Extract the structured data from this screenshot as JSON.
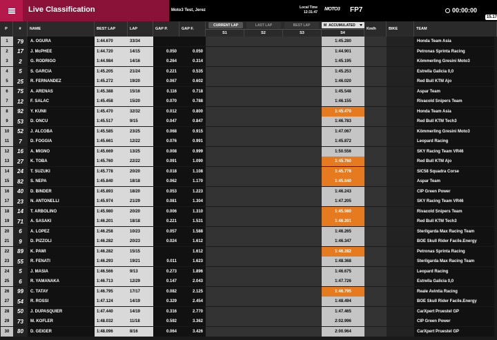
{
  "header": {
    "title": "Live Classification",
    "session": "Moto3 Test, Jerez",
    "local_time_label": "Local Time",
    "local_time": "12:31:47",
    "logo_text": "MOTO3",
    "session_code": "FP7",
    "clock": "00:00:00",
    "side_tag": "15.17"
  },
  "columns": {
    "p": "P",
    "num": "#",
    "name": "NAME",
    "best_lap": "BEST LAP",
    "lap": "LAP",
    "gap_p": "GAP P.",
    "gap_f": "GAP F.",
    "current_lap": "CURRENT LAP",
    "last_lap": "LAST LAP",
    "best_lap_pill": "BEST LAP",
    "s1": "S1",
    "s2": "S2",
    "s3": "S3",
    "s4": "S4",
    "kmh": "Km/h",
    "bike": "BIKE",
    "team": "TEAM",
    "mode_select": "ACCUMULATED",
    "mode_prefix": "M"
  },
  "colors": {
    "accent": "#b5184a",
    "highlight": "#e57a1f"
  },
  "rows": [
    {
      "p": "1",
      "num": "79",
      "name": "A. OGURA",
      "best": "1:44.670",
      "lap": "33/34",
      "gapp": "",
      "gapf": "",
      "s4": "1:45.280",
      "hl": false,
      "team": "Honda Team Asia"
    },
    {
      "p": "2",
      "num": "17",
      "name": "J. McPHEE",
      "best": "1:44.720",
      "lap": "14/15",
      "gapp": "0.050",
      "gapf": "0.050",
      "s4": "1:44.901",
      "hl": false,
      "team": "Petronas Sprinta Racing"
    },
    {
      "p": "3",
      "num": "2",
      "name": "G. RODRIGO",
      "best": "1:44.984",
      "lap": "14/16",
      "gapp": "0.264",
      "gapf": "0.314",
      "s4": "1:45.195",
      "hl": false,
      "team": "Kömmerling Gresini Moto3"
    },
    {
      "p": "4",
      "num": "5",
      "name": "S. GARCIA",
      "best": "1:45.205",
      "lap": "21/24",
      "gapp": "0.221",
      "gapf": "0.535",
      "s4": "1:45.253",
      "hl": false,
      "team": "Estrella Galicia 0,0"
    },
    {
      "p": "5",
      "num": "25",
      "name": "R. FERNANDEZ",
      "best": "1:45.272",
      "lap": "19/20",
      "gapp": "0.067",
      "gapf": "0.602",
      "s4": "1:46.020",
      "hl": false,
      "team": "Red Bull KTM Ajo"
    },
    {
      "p": "6",
      "num": "75",
      "name": "A. ARENAS",
      "best": "1:45.388",
      "lap": "15/16",
      "gapp": "0.116",
      "gapf": "0.718",
      "s4": "1:45.548",
      "hl": false,
      "team": "Aspar Team"
    },
    {
      "p": "7",
      "num": "12",
      "name": "F. SALAC",
      "best": "1:45.458",
      "lap": "15/20",
      "gapp": "0.070",
      "gapf": "0.788",
      "s4": "1:46.155",
      "hl": false,
      "team": "Rivacold Snipers Team"
    },
    {
      "p": "8",
      "num": "92",
      "name": "Y. KUNII",
      "best": "1:45.470",
      "lap": "32/32",
      "gapp": "0.012",
      "gapf": "0.800",
      "s4": "1:45.470",
      "hl": true,
      "team": "Honda Team Asia"
    },
    {
      "p": "9",
      "num": "53",
      "name": "D. ONCU",
      "best": "1:45.517",
      "lap": "9/15",
      "gapp": "0.047",
      "gapf": "0.847",
      "s4": "1:46.783",
      "hl": false,
      "team": "Red Bull KTM Tech3"
    },
    {
      "p": "10",
      "num": "52",
      "name": "J. ALCOBA",
      "best": "1:45.585",
      "lap": "23/25",
      "gapp": "0.068",
      "gapf": "0.915",
      "s4": "1:47.067",
      "hl": false,
      "team": "Kömmerling Gresini Moto3"
    },
    {
      "p": "11",
      "num": "7",
      "name": "D. FOGGIA",
      "best": "1:45.661",
      "lap": "12/22",
      "gapp": "0.076",
      "gapf": "0.991",
      "s4": "1:45.872",
      "hl": false,
      "team": "Leopard Racing"
    },
    {
      "p": "12",
      "num": "16",
      "name": "A. MIGNO",
      "best": "1:45.669",
      "lap": "13/25",
      "gapp": "0.008",
      "gapf": "0.999",
      "s4": "1:50.556",
      "hl": false,
      "team": "SKY Racing Team VR46"
    },
    {
      "p": "13",
      "num": "27",
      "name": "K. TOBA",
      "best": "1:45.760",
      "lap": "22/22",
      "gapp": "0.091",
      "gapf": "1.090",
      "s4": "1:45.760",
      "hl": true,
      "team": "Red Bull KTM Ajo"
    },
    {
      "p": "14",
      "num": "24",
      "name": "T. SUZUKI",
      "best": "1:45.778",
      "lap": "20/20",
      "gapp": "0.018",
      "gapf": "1.108",
      "s4": "1:45.778",
      "hl": true,
      "team": "SIC58 Squadra Corse"
    },
    {
      "p": "15",
      "num": "82",
      "name": "S. NEPA",
      "best": "1:45.840",
      "lap": "18/18",
      "gapp": "0.062",
      "gapf": "1.170",
      "s4": "1:45.840",
      "hl": true,
      "team": "Aspar Team"
    },
    {
      "p": "16",
      "num": "40",
      "name": "D. BINDER",
      "best": "1:45.893",
      "lap": "18/20",
      "gapp": "0.053",
      "gapf": "1.223",
      "s4": "1:46.243",
      "hl": false,
      "team": "CIP Green Power"
    },
    {
      "p": "17",
      "num": "23",
      "name": "N. ANTONELLI",
      "best": "1:45.974",
      "lap": "21/29",
      "gapp": "0.081",
      "gapf": "1.304",
      "s4": "1:47.205",
      "hl": false,
      "team": "SKY Racing Team VR46"
    },
    {
      "p": "18",
      "num": "14",
      "name": "T. ARBOLINO",
      "best": "1:45.980",
      "lap": "20/20",
      "gapp": "0.006",
      "gapf": "1.310",
      "s4": "1:45.980",
      "hl": true,
      "team": "Rivacold Snipers Team"
    },
    {
      "p": "19",
      "num": "71",
      "name": "A. SASAKI",
      "best": "1:46.201",
      "lap": "18/18",
      "gapp": "0.221",
      "gapf": "1.531",
      "s4": "1:46.201",
      "hl": true,
      "team": "Red Bull KTM Tech3"
    },
    {
      "p": "20",
      "num": "6",
      "name": "A. LOPEZ",
      "best": "1:46.258",
      "lap": "10/23",
      "gapp": "0.057",
      "gapf": "1.588",
      "s4": "1:46.265",
      "hl": false,
      "team": "Sterilgarda Max Racing Team"
    },
    {
      "p": "21",
      "num": "9",
      "name": "D. PIZZOLI",
      "best": "1:46.282",
      "lap": "20/23",
      "gapp": "0.024",
      "gapf": "1.612",
      "s4": "1:46.347",
      "hl": false,
      "team": "BOE Skull Rider Facile.Energy"
    },
    {
      "p": "22",
      "num": "89",
      "name": "K. PAWI",
      "best": "1:46.282",
      "lap": "15/15",
      "gapp": "",
      "gapf": "1.612",
      "s4": "1:46.282",
      "hl": true,
      "team": "Petronas Sprinta Racing"
    },
    {
      "p": "23",
      "num": "55",
      "name": "R. FENATI",
      "best": "1:46.293",
      "lap": "19/21",
      "gapp": "0.011",
      "gapf": "1.623",
      "s4": "1:48.368",
      "hl": false,
      "team": "Sterilgarda Max Racing Team"
    },
    {
      "p": "24",
      "num": "5",
      "name": "J. MASIA",
      "best": "1:46.566",
      "lap": "9/13",
      "gapp": "0.273",
      "gapf": "1.896",
      "s4": "1:46.675",
      "hl": false,
      "team": "Leopard Racing"
    },
    {
      "p": "25",
      "num": "6",
      "name": "R. YAMANAKA",
      "best": "1:46.713",
      "lap": "12/29",
      "gapp": "0.147",
      "gapf": "2.043",
      "s4": "1:47.726",
      "hl": false,
      "team": "Estrella Galicia 0,0"
    },
    {
      "p": "26",
      "num": "99",
      "name": "C. TATAY",
      "best": "1:46.795",
      "lap": "17/17",
      "gapp": "0.082",
      "gapf": "2.125",
      "s4": "1:46.795",
      "hl": true,
      "team": "Reale Avintia Racing"
    },
    {
      "p": "27",
      "num": "54",
      "name": "R. ROSSI",
      "best": "1:47.124",
      "lap": "14/19",
      "gapp": "0.329",
      "gapf": "2.454",
      "s4": "1:48.494",
      "hl": false,
      "team": "BOE Skull Rider Facile.Energy"
    },
    {
      "p": "28",
      "num": "50",
      "name": "J. DUPASQUIER",
      "best": "1:47.440",
      "lap": "14/19",
      "gapp": "0.316",
      "gapf": "2.770",
      "s4": "1:47.465",
      "hl": false,
      "team": "CarXpert Pruestel GP"
    },
    {
      "p": "29",
      "num": "73",
      "name": "M. KOFLER",
      "best": "1:48.032",
      "lap": "11/18",
      "gapp": "0.592",
      "gapf": "3.362",
      "s4": "2:02.996",
      "hl": false,
      "team": "CIP Green Power"
    },
    {
      "p": "30",
      "num": "80",
      "name": "D. GEIGER",
      "best": "1:48.096",
      "lap": "8/16",
      "gapp": "0.064",
      "gapf": "3.426",
      "s4": "2:00.964",
      "hl": false,
      "team": "CarXpert Pruestel GP"
    }
  ]
}
